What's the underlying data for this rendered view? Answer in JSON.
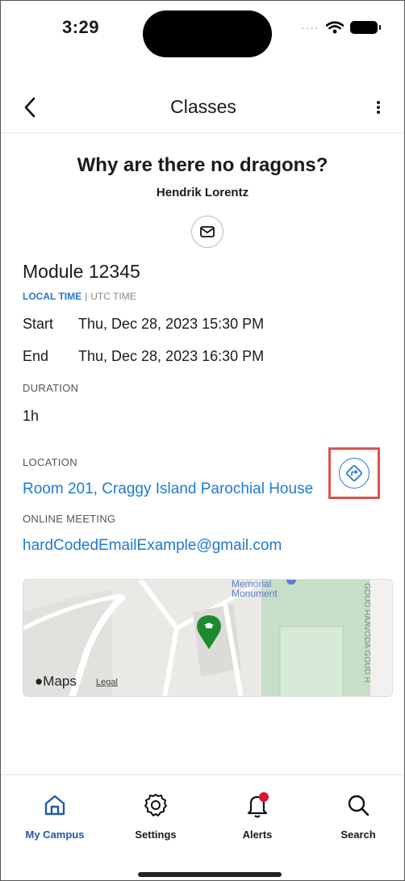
{
  "status_bar": {
    "time": "3:29"
  },
  "header": {
    "title": "Classes"
  },
  "class": {
    "title": "Why are there no dragons?",
    "instructor": "Hendrik Lorentz",
    "module": "Module 12345"
  },
  "time_toggle": {
    "local": "LOCAL TIME",
    "separator": "|",
    "utc": "UTC TIME"
  },
  "schedule": {
    "start_label": "Start",
    "start_value": "Thu, Dec 28, 2023 15:30 PM",
    "end_label": "End",
    "end_value": "Thu, Dec 28, 2023 16:30 PM"
  },
  "duration": {
    "label": "DURATION",
    "value": "1h"
  },
  "location": {
    "label": "LOCATION",
    "value": "Room 201, Craggy Island Parochial House"
  },
  "online_meeting": {
    "label": "ONLINE MEETING",
    "value": "hardCodedEmailExample@gmail.com"
  },
  "map": {
    "poi_label_1": "Memorial",
    "poi_label_2": "Monument",
    "street_label": "GOUD HAAVODA GOUD H",
    "brand": "Maps",
    "legal": "Legal"
  },
  "tabs": [
    {
      "label": "My Campus",
      "icon": "home-icon",
      "active": true
    },
    {
      "label": "Settings",
      "icon": "gear-icon",
      "active": false
    },
    {
      "label": "Alerts",
      "icon": "bell-icon",
      "active": false
    },
    {
      "label": "Search",
      "icon": "search-icon",
      "active": false
    }
  ],
  "colors": {
    "accent": "#1f7ad4",
    "highlight_box": "#d9534f",
    "map_pin": "#1e8a2e"
  }
}
